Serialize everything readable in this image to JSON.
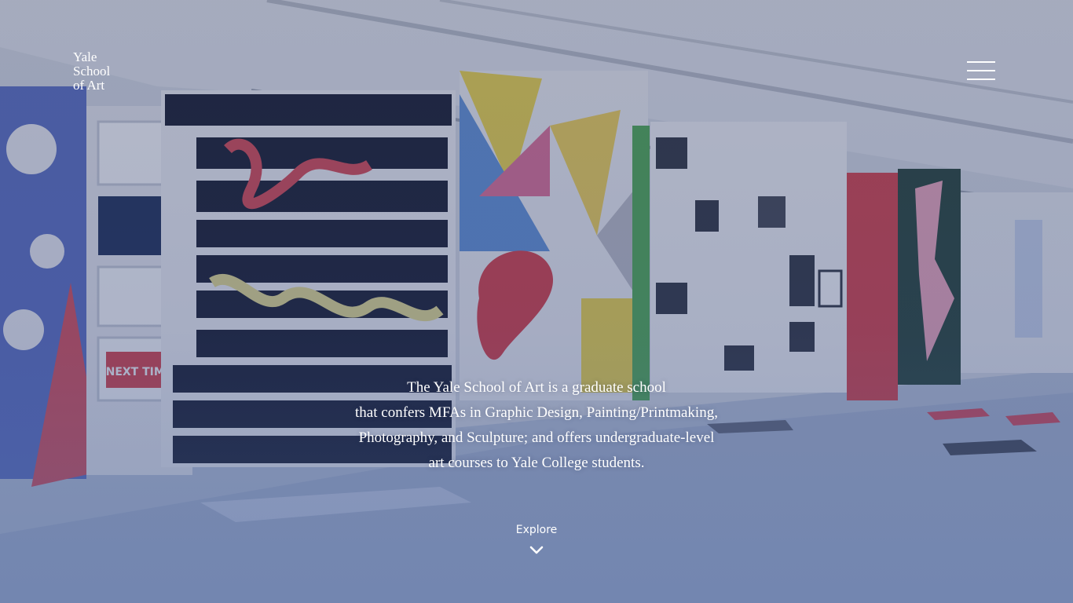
{
  "logo": {
    "line1": "Yale",
    "line2": "School",
    "line3": "of Art"
  },
  "menu": {
    "icon": "hamburger-menu-icon"
  },
  "intro": {
    "lines": [
      "The Yale School of Art is a graduate school",
      "that confers MFAs in Graphic Design, Painting/Printmaking,",
      "Photography, and Sculpture; and offers undergraduate-level",
      "art courses to Yale College students."
    ]
  },
  "explore": {
    "label": "Explore",
    "icon": "chevron-down-icon"
  }
}
